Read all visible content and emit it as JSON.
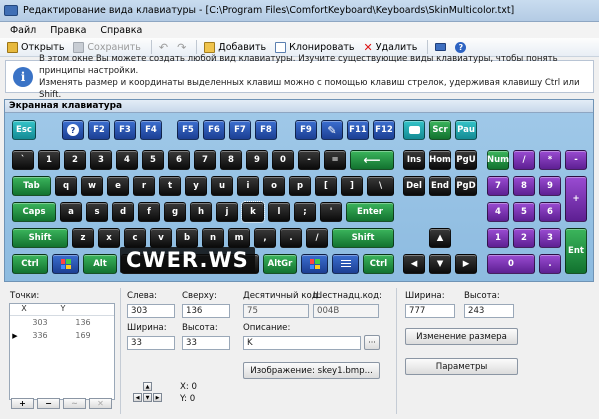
{
  "window": {
    "title": "Редактирование вида клавиатуры - [C:\\Program Files\\ComfortKeyboard\\Keyboards\\SkinMulticolor.txt]"
  },
  "menu": [
    "Файл",
    "Правка",
    "Справка"
  ],
  "toolbar": {
    "open": "Открыть",
    "save": "Сохранить",
    "add": "Добавить",
    "clone": "Клонировать",
    "delete": "Удалить"
  },
  "info": {
    "line1": "В этом окне Вы можете создать любой вид клавиатуры. Изучите существующие виды клавиатуры, чтобы понять принципы настройки.",
    "line2": "Изменять размер и координаты выделенных клавиш можно с помощью клавиш стрелок, удерживая клавишу Ctrl или Shift."
  },
  "keyboard_title": "Экранная клавиатура",
  "keys": {
    "esc": "Esc",
    "f2": "F2",
    "f3": "F3",
    "f4": "F4",
    "f5": "F5",
    "f6": "F6",
    "f7": "F7",
    "f8": "F8",
    "f9": "F9",
    "f11": "F11",
    "f12": "F12",
    "scr": "Scr",
    "pau": "Pau",
    "grave": "`",
    "n1": "1",
    "n2": "2",
    "n3": "3",
    "n4": "4",
    "n5": "5",
    "n6": "6",
    "n7": "7",
    "n8": "8",
    "n9": "9",
    "n0": "0",
    "minus": "-",
    "equal": "=",
    "ins": "Ins",
    "hom": "Hom",
    "pgu": "PgU",
    "num": "Num",
    "div": "/",
    "mul": "*",
    "sub": "-",
    "tab": "Tab",
    "q": "q",
    "w": "w",
    "e": "e",
    "r": "r",
    "t": "t",
    "y": "y",
    "u": "u",
    "i": "i",
    "o": "o",
    "p": "p",
    "lbr": "[",
    "rbr": "]",
    "bsl": "\\",
    "del": "Del",
    "end": "End",
    "pgd": "PgD",
    "np7": "7",
    "np8": "8",
    "np9": "9",
    "add": "+",
    "caps": "Caps",
    "a": "a",
    "s": "s",
    "d": "d",
    "f": "f",
    "g": "g",
    "h": "h",
    "j": "j",
    "k": "k",
    "l": "l",
    "semi": ";",
    "quot": "'",
    "enter": "Enter",
    "np4": "4",
    "np5": "5",
    "np6": "6",
    "lshift": "Shift",
    "z": "z",
    "x": "x",
    "c": "c",
    "v": "v",
    "b": "b",
    "n": "n",
    "m": "m",
    "comma": ",",
    "dot": ".",
    "slash": "/",
    "rshift": "Shift",
    "np1": "1",
    "np2": "2",
    "np3": "3",
    "npent": "Ent",
    "lctrl": "Ctrl",
    "alt": "Alt",
    "altgr": "AltGr",
    "rctrl": "Ctrl",
    "np0": "0",
    "npdot": "."
  },
  "watermark": "CWER.WS",
  "points": {
    "label": "Точки:",
    "col_x": "X",
    "col_y": "Y",
    "rows": [
      [
        "303",
        "136"
      ],
      [
        "336",
        "169"
      ]
    ]
  },
  "props": {
    "left_label": "Слева:",
    "left": "303",
    "top_label": "Сверху:",
    "top": "136",
    "dec_label": "Десятичный код:",
    "dec": "75",
    "hex_label": "Шестнадц.код:",
    "hex": "004B",
    "width_label": "Ширина:",
    "width": "33",
    "height_label": "Высота:",
    "height": "33",
    "desc_label": "Описание:",
    "desc": "K",
    "image_button": "Изображение: skey1.bmp...",
    "coord_x": "X: 0",
    "coord_y": "Y: 0"
  },
  "size": {
    "width_label": "Ширина:",
    "width": "777",
    "height_label": "Высота:",
    "height": "243",
    "resize_button": "Изменение размера",
    "params_button": "Параметры"
  },
  "colors": {
    "blue": "#1c3f93",
    "teal": "#138a94",
    "black": "#0a0a0a",
    "green": "#12722f",
    "purple": "#5d1f92",
    "panel": "#9cc6e6"
  }
}
